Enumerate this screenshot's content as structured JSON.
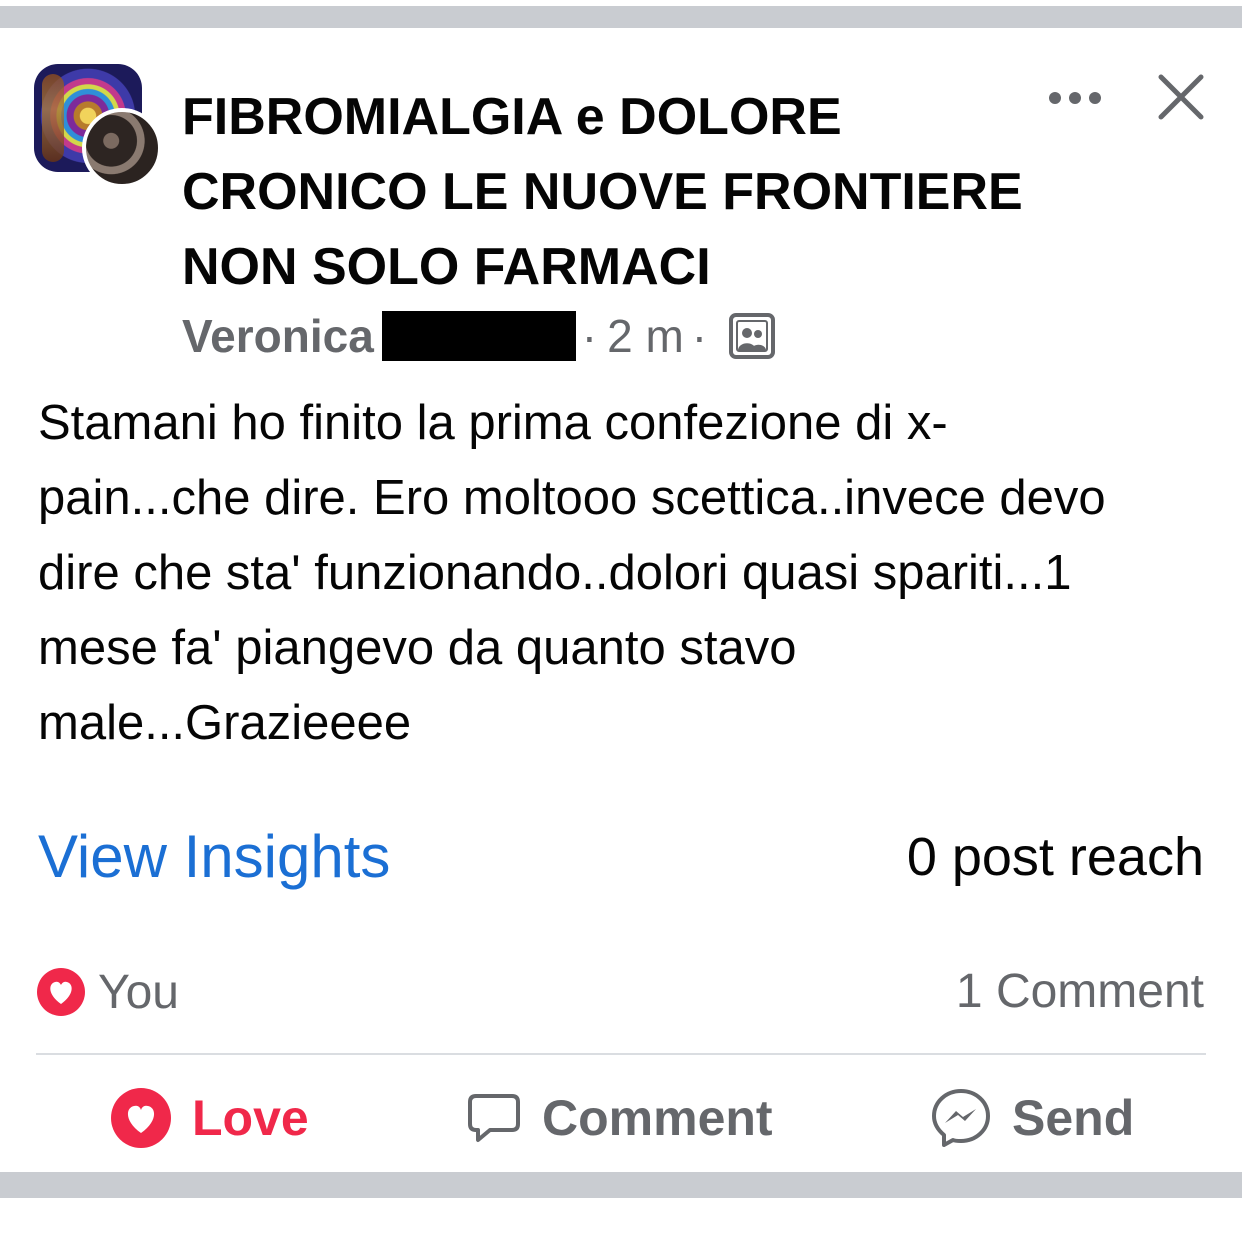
{
  "header": {
    "group_name": "FIBROMIALGIA e DOLORE CRONICO LE NUOVE FRONTIERE NON SOLO FARMACI",
    "author": "Veronica",
    "separator": "·",
    "time": "2 m",
    "audience_icon": "group-audience-icon"
  },
  "post": {
    "text": "Stamani ho finito la prima confezione di x-pain...che dire. Ero moltooo scettica..invece devo dire che sta' funzionando..dolori quasi spariti...1 mese fa' piangevo da quanto stavo male...Grazieeee"
  },
  "insights": {
    "link_label": "View Insights",
    "reach_label": "0 post reach"
  },
  "engagement": {
    "reactor": "You",
    "comment_count": "1 Comment"
  },
  "actions": {
    "love": "Love",
    "comment": "Comment",
    "send": "Send"
  },
  "colors": {
    "love": "#f0284a",
    "link": "#1b6fd4",
    "secondary_text": "#65676b"
  }
}
